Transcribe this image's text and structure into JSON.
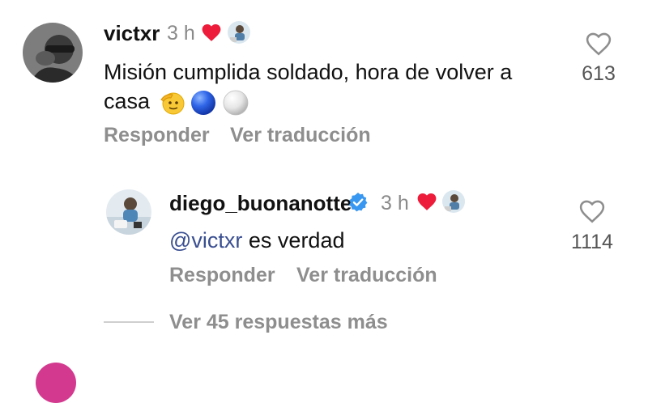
{
  "comments": [
    {
      "username": "victxr",
      "time": "3 h",
      "verified": false,
      "text_line1": "Misión cumplida soldado, hora de volver a",
      "text_line2": "casa",
      "emojis": [
        "saluting-face",
        "blue-circle",
        "white-circle"
      ],
      "likes": "613",
      "reply_label": "Responder",
      "translate_label": "Ver traducción"
    },
    {
      "username": "diego_buonanotte",
      "time": "3 h",
      "verified": true,
      "mention": "@victxr",
      "text_rest": " es verdad",
      "likes": "1114",
      "reply_label": "Responder",
      "translate_label": "Ver traducción"
    }
  ],
  "view_more": "Ver 45 respuestas más",
  "colors": {
    "heart_red": "#ed1c3a",
    "verified_blue": "#3897f0",
    "mention_blue": "#3a4f91",
    "muted_gray": "#8e8e8e"
  },
  "icons": [
    "heart-filled-icon",
    "heart-outline-icon",
    "verified-badge-icon"
  ]
}
